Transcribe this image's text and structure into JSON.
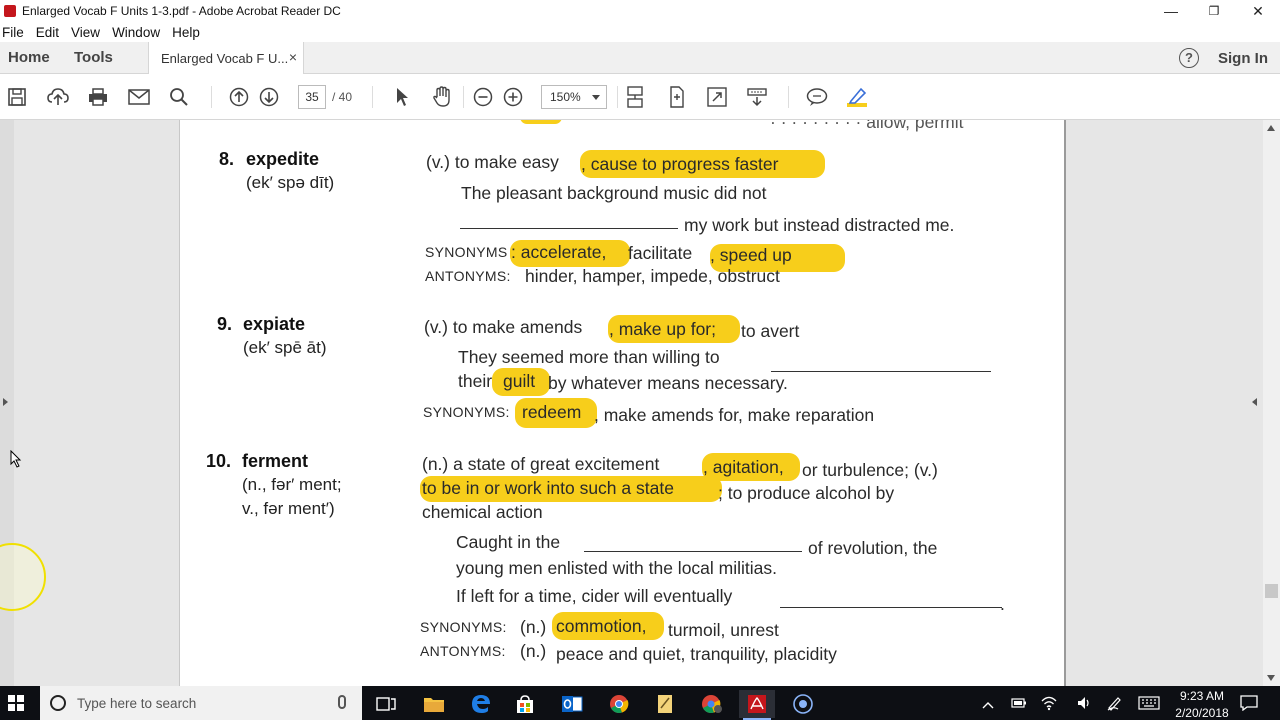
{
  "window": {
    "title": "Enlarged Vocab F Units 1-3.pdf - Adobe Acrobat Reader DC",
    "minimize": "—",
    "restore": "❐",
    "close": "✕"
  },
  "menu": [
    "File",
    "Edit",
    "View",
    "Window",
    "Help"
  ],
  "tabs": {
    "home": "Home",
    "tools": "Tools",
    "document": "Enlarged Vocab F U...",
    "close": "×",
    "help": "?",
    "sign_in": "Sign In"
  },
  "toolbar": {
    "page_current": "35",
    "page_total": "/ 40",
    "zoom": "150%"
  },
  "document": {
    "top_fragment": "· · · · · · · · · allow, permit",
    "entries": [
      {
        "number": "8.",
        "word": "expedite",
        "pron": "(ek′ spə dīt)",
        "def_a": "(v.) to make easy",
        "def_hl": ", cause to progress faster",
        "example_1": "The pleasant background music did not",
        "example_2": "my work but instead distracted me.",
        "syn_label": "SYNONYMS",
        "syn_hl_1": ": accelerate,",
        "syn_mid": " facilitate",
        "syn_hl_2": ", speed up",
        "ant_label": "ANTONYMS:",
        "ant_text": "hinder, hamper, impede, obstruct"
      },
      {
        "number": "9.",
        "word": "expiate",
        "pron": "(ek′ spē āt)",
        "def_a": "(v.) to make amends",
        "def_hl": ", make up for;",
        "def_b": "to avert",
        "example_1": "They seemed more than willing to",
        "example_2a": "their",
        "example_hl": "guilt",
        "example_2b": "by whatever means necessary.",
        "syn_label": "SYNONYMS:",
        "syn_hl": "redeem",
        "syn_text": ", make amends for, make reparation"
      },
      {
        "number": "10.",
        "word": "ferment",
        "pron_1": "(n., fər′ ment;",
        "pron_2": "v., fər ment′)",
        "def_a": "(n.) a state of great excitement",
        "def_hl": ", agitation,",
        "def_b": "or turbulence; (v.)",
        "def_hl_2": "to be in or work into such a state",
        "def_c": "; to produce alcohol by",
        "def_d": "chemical action",
        "example_1a": "Caught in the",
        "example_1b": "of revolution, the",
        "example_2": "young men enlisted with the local militias.",
        "example_3": "If left for a time, cider will eventually",
        "example_3end": ".",
        "syn_label": "SYNONYMS:",
        "syn_n": "(n.)",
        "syn_hl": "commotion,",
        "syn_text": "turmoil, unrest",
        "ant_label": "ANTONYMS:",
        "ant_n": "(n.)",
        "ant_text": "peace and quiet, tranquility, placidity"
      }
    ]
  },
  "taskbar": {
    "search_placeholder": "Type here to search",
    "time": "9:23 AM",
    "date": "2/20/2018"
  },
  "colors": {
    "highlight": "#f7ce1b",
    "taskbar": "#0d0f14",
    "acrobat_red": "#c4161c"
  }
}
